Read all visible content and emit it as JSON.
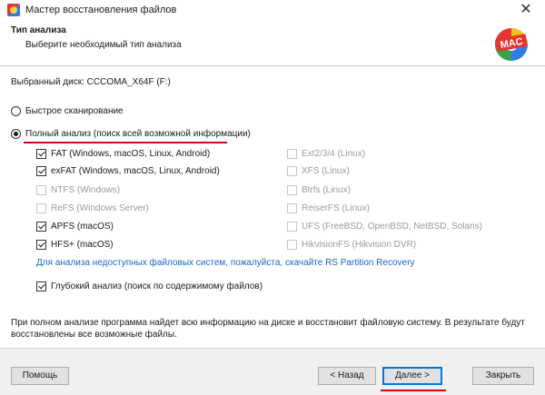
{
  "window": {
    "title": "Мастер восстановления файлов",
    "close_glyph": "✕"
  },
  "header": {
    "title": "Тип анализа",
    "subtitle": "Выберите необходимый тип анализа",
    "logo_text": "MAC"
  },
  "disk": {
    "label": "Выбранный диск: CCCOMA_X64F (F:)"
  },
  "scan_options": {
    "quick": {
      "label": "Быстрое сканирование",
      "selected": false
    },
    "full": {
      "label": "Полный анализ (поиск всей возможной информации)",
      "selected": true
    }
  },
  "filesystems_left": [
    {
      "label": "FAT (Windows, macOS, Linux, Android)",
      "checked": true,
      "enabled": true
    },
    {
      "label": "exFAT (Windows, macOS, Linux, Android)",
      "checked": true,
      "enabled": true
    },
    {
      "label": "NTFS (Windows)",
      "checked": false,
      "enabled": false
    },
    {
      "label": "ReFS (Windows Server)",
      "checked": false,
      "enabled": false
    },
    {
      "label": "APFS (macOS)",
      "checked": true,
      "enabled": true
    },
    {
      "label": "HFS+ (macOS)",
      "checked": true,
      "enabled": true
    }
  ],
  "filesystems_right": [
    {
      "label": "Ext2/3/4 (Linux)",
      "checked": false,
      "enabled": false
    },
    {
      "label": "XFS (Linux)",
      "checked": false,
      "enabled": false
    },
    {
      "label": "Btrfs (Linux)",
      "checked": false,
      "enabled": false
    },
    {
      "label": "ReiserFS (Linux)",
      "checked": false,
      "enabled": false
    },
    {
      "label": "UFS (FreeBSD, OpenBSD, NetBSD, Solaris)",
      "checked": false,
      "enabled": false
    },
    {
      "label": "HikvisionFS (Hikvision DVR)",
      "checked": false,
      "enabled": false
    }
  ],
  "link": {
    "text": "Для анализа недоступных файловых систем, пожалуйста, скачайте RS Partition Recovery"
  },
  "deep": {
    "label": "Глубокий анализ (поиск по содержимому файлов)",
    "checked": true
  },
  "info": {
    "line1": "При полном анализе программа найдет всю информацию на диске и восстановит файловую систему. В результате будут",
    "line2": "восстановлены все возможные файлы."
  },
  "buttons": {
    "help": "Помощь",
    "back": "< Назад",
    "next": "Далее >",
    "close": "Закрыть"
  },
  "colors": {
    "accent_underline": "#d9001b",
    "link": "#1668c4",
    "default_button_border": "#0078d7"
  }
}
